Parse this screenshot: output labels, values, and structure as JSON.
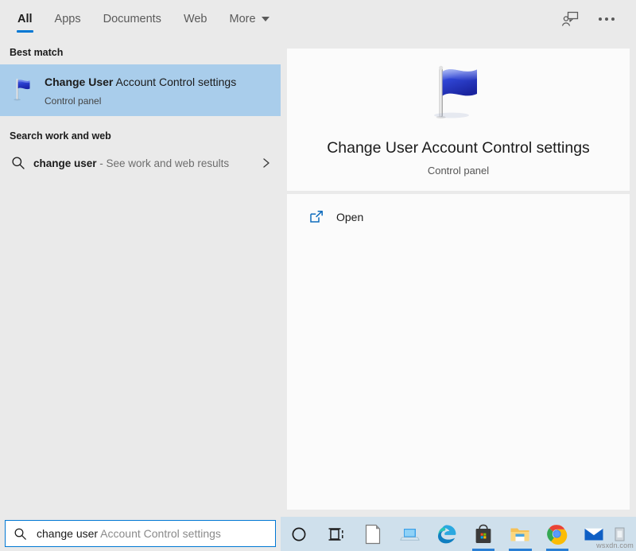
{
  "header": {
    "tabs": [
      {
        "label": "All",
        "active": true
      },
      {
        "label": "Apps",
        "active": false
      },
      {
        "label": "Documents",
        "active": false
      },
      {
        "label": "Web",
        "active": false
      },
      {
        "label": "More",
        "active": false,
        "has_caret": true
      }
    ],
    "feedback_icon": "feedback-person-icon",
    "more_options_icon": "ellipsis-icon"
  },
  "left_pane": {
    "best_match_label": "Best match",
    "best_match": {
      "title_bold": "Change User",
      "title_rest": " Account Control settings",
      "subtitle": "Control panel",
      "icon": "uac-flag-icon",
      "selected": true
    },
    "web_section_label": "Search work and web",
    "web_result": {
      "query": "change user",
      "suffix": " - See work and web results",
      "icon": "search-icon",
      "chevron": "chevron-right-icon"
    }
  },
  "preview": {
    "icon": "uac-flag-icon",
    "title": "Change User Account Control settings",
    "subtitle": "Control panel",
    "actions": [
      {
        "label": "Open",
        "icon": "open-external-icon"
      }
    ]
  },
  "search": {
    "icon": "search-icon",
    "typed_text": "change user",
    "suggestion_text": " Account Control settings"
  },
  "taskbar": {
    "items": [
      {
        "name": "cortana",
        "icon": "cortana-circle-icon",
        "active": false
      },
      {
        "name": "task-view",
        "icon": "task-view-icon",
        "active": false
      },
      {
        "name": "libreoffice",
        "icon": "document-icon",
        "active": false
      },
      {
        "name": "remote-desktop",
        "icon": "laptop-icon",
        "active": false
      },
      {
        "name": "microsoft-edge",
        "icon": "edge-icon",
        "active": false
      },
      {
        "name": "microsoft-store",
        "icon": "store-bag-icon",
        "active": true
      },
      {
        "name": "file-explorer",
        "icon": "folder-icon",
        "active": true
      },
      {
        "name": "google-chrome",
        "icon": "chrome-icon",
        "active": true
      },
      {
        "name": "mail",
        "icon": "envelope-icon",
        "active": false
      },
      {
        "name": "partial-app",
        "icon": "app-icon",
        "active": false
      }
    ],
    "watermark": "wsxdn.com"
  },
  "colors": {
    "accent": "#0078d4",
    "selection": "#a9cdeb",
    "pane_bg": "#eaeaea",
    "card_bg": "#fbfbfb",
    "taskbar_bg": "#cfe0ec"
  }
}
